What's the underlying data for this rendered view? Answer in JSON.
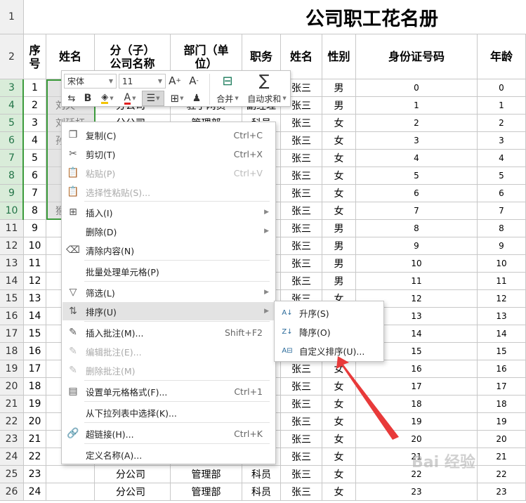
{
  "sheet": {
    "title": "公司职工花名册",
    "headers": [
      "序号",
      "姓名",
      "分（子）公司名称",
      "部门（单位）",
      "职务",
      "姓名",
      "性别",
      "身份证号码",
      "年龄"
    ],
    "row_numbers": [
      "1",
      "2",
      "3",
      "4",
      "5",
      "6",
      "7",
      "8",
      "9",
      "10",
      "11",
      "12",
      "13",
      "14",
      "15",
      "16",
      "17",
      "18",
      "19",
      "20",
      "21",
      "22",
      "23",
      "24",
      "25",
      "26"
    ],
    "rows": [
      [
        "1",
        "",
        "",
        "",
        "",
        "张三",
        "男",
        "0",
        "0"
      ],
      [
        "2",
        "刘天",
        "分公司",
        "驻于网员",
        "副经理",
        "张三",
        "男",
        "1",
        "1"
      ],
      [
        "3",
        "刘廷杆",
        "分公司",
        "管理部",
        "科员",
        "张三",
        "女",
        "2",
        "2"
      ],
      [
        "4",
        "孙",
        "",
        "",
        "",
        "张三",
        "女",
        "3",
        "3"
      ],
      [
        "5",
        "",
        "",
        "",
        "",
        "张三",
        "女",
        "4",
        "4"
      ],
      [
        "6",
        "",
        "",
        "",
        "",
        "张三",
        "女",
        "5",
        "5"
      ],
      [
        "7",
        "",
        "",
        "",
        "",
        "张三",
        "女",
        "6",
        "6"
      ],
      [
        "8",
        "猴",
        "",
        "",
        "",
        "张三",
        "女",
        "7",
        "7"
      ],
      [
        "9",
        "",
        "",
        "",
        "",
        "张三",
        "男",
        "8",
        "8"
      ],
      [
        "10",
        "",
        "",
        "",
        "",
        "张三",
        "男",
        "9",
        "9"
      ],
      [
        "11",
        "",
        "",
        "",
        "",
        "张三",
        "男",
        "10",
        "10"
      ],
      [
        "12",
        "",
        "",
        "",
        "",
        "张三",
        "男",
        "11",
        "11"
      ],
      [
        "13",
        "",
        "",
        "",
        "",
        "张三",
        "女",
        "12",
        "12"
      ],
      [
        "14",
        "",
        "",
        "",
        "",
        "张三",
        "女",
        "13",
        "13"
      ],
      [
        "15",
        "",
        "",
        "",
        "",
        "张三",
        "女",
        "14",
        "14"
      ],
      [
        "16",
        "",
        "",
        "",
        "",
        "张三",
        "女",
        "15",
        "15"
      ],
      [
        "17",
        "",
        "",
        "",
        "",
        "张三",
        "女",
        "16",
        "16"
      ],
      [
        "18",
        "",
        "",
        "",
        "",
        "张三",
        "女",
        "17",
        "17"
      ],
      [
        "19",
        "",
        "",
        "",
        "",
        "张三",
        "女",
        "18",
        "18"
      ],
      [
        "20",
        "",
        "",
        "",
        "",
        "张三",
        "女",
        "19",
        "19"
      ],
      [
        "21",
        "",
        "",
        "",
        "",
        "张三",
        "女",
        "20",
        "20"
      ],
      [
        "22",
        "",
        "",
        "",
        "",
        "张三",
        "女",
        "21",
        "21"
      ],
      [
        "23",
        "",
        "分公司",
        "管理部",
        "科员",
        "张三",
        "女",
        "22",
        "22"
      ],
      [
        "24",
        "",
        "分公司",
        "管理部",
        "科员",
        "张三",
        "女",
        "23",
        "23"
      ]
    ]
  },
  "mini_toolbar": {
    "font_name": "宋体",
    "font_size": "11",
    "merge_label": "合并",
    "autosum_label": "自动求和"
  },
  "context_menu": [
    {
      "icon": "copy-icon",
      "glyph": "❐",
      "label": "复制(C)",
      "shortcut": "Ctrl+C",
      "disabled": false
    },
    {
      "icon": "cut-icon",
      "glyph": "✂",
      "label": "剪切(T)",
      "shortcut": "Ctrl+X",
      "disabled": false
    },
    {
      "icon": "paste-icon",
      "glyph": "📋",
      "label": "粘贴(P)",
      "shortcut": "Ctrl+V",
      "disabled": true
    },
    {
      "icon": "paste-special-icon",
      "glyph": "📋",
      "label": "选择性粘贴(S)...",
      "shortcut": "",
      "disabled": true
    },
    {
      "icon": "insert-icon",
      "glyph": "⊞",
      "label": "插入(I)",
      "shortcut": "",
      "submenu": true,
      "disabled": false
    },
    {
      "icon": "",
      "glyph": "",
      "label": "删除(D)",
      "shortcut": "",
      "submenu": true,
      "disabled": false
    },
    {
      "icon": "clear-icon",
      "glyph": "⌫",
      "label": "清除内容(N)",
      "shortcut": "",
      "disabled": false
    },
    {
      "icon": "",
      "glyph": "",
      "label": "批量处理单元格(P)",
      "shortcut": "",
      "disabled": false
    },
    {
      "icon": "filter-icon",
      "glyph": "▽",
      "label": "筛选(L)",
      "shortcut": "",
      "submenu": true,
      "disabled": false
    },
    {
      "icon": "sort-icon",
      "glyph": "⇅",
      "label": "排序(U)",
      "shortcut": "",
      "submenu": true,
      "disabled": false,
      "highlight": true
    },
    {
      "icon": "insert-comment-icon",
      "glyph": "✎",
      "label": "插入批注(M)...",
      "shortcut": "Shift+F2",
      "disabled": false
    },
    {
      "icon": "edit-comment-icon",
      "glyph": "✎",
      "label": "编辑批注(E)...",
      "shortcut": "",
      "disabled": true
    },
    {
      "icon": "delete-comment-icon",
      "glyph": "✎",
      "label": "删除批注(M)",
      "shortcut": "",
      "disabled": true
    },
    {
      "icon": "format-cells-icon",
      "glyph": "▤",
      "label": "设置单元格格式(F)...",
      "shortcut": "Ctrl+1",
      "disabled": false
    },
    {
      "icon": "",
      "glyph": "",
      "label": "从下拉列表中选择(K)...",
      "shortcut": "",
      "disabled": false
    },
    {
      "icon": "hyperlink-icon",
      "glyph": "🔗",
      "label": "超链接(H)...",
      "shortcut": "Ctrl+K",
      "disabled": false
    },
    {
      "icon": "",
      "glyph": "",
      "label": "定义名称(A)...",
      "shortcut": "",
      "disabled": false
    }
  ],
  "sort_submenu": [
    {
      "icon": "sort-ascending-icon",
      "label": "升序(S)"
    },
    {
      "icon": "sort-descending-icon",
      "label": "降序(O)"
    },
    {
      "icon": "custom-sort-icon",
      "label": "自定义排序(U)..."
    }
  ],
  "watermark": "Bai 经验",
  "colors": {
    "selection": "#3c9b3c",
    "arrow": "#e83a3a",
    "menu_highlight": "#e3e3e3"
  }
}
